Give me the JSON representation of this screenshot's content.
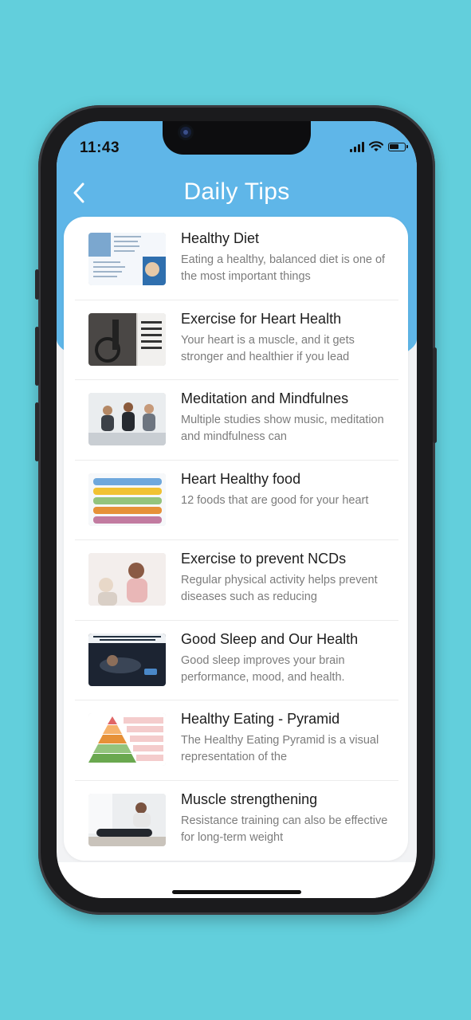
{
  "status": {
    "time": "11:43"
  },
  "nav": {
    "title": "Daily Tips",
    "back_icon": "chevron-left-icon"
  },
  "tips": [
    {
      "title": "Healthy Diet",
      "desc": "Eating a healthy, balanced diet is one of the most important things"
    },
    {
      "title": "Exercise for Heart Health",
      "desc": "Your heart is a muscle, and it gets stronger and healthier if you lead"
    },
    {
      "title": "Meditation and Mindfulnes",
      "desc": "Multiple studies show music, meditation and mindfulness can"
    },
    {
      "title": "Heart Healthy food",
      "desc": "12 foods that are good for your heart"
    },
    {
      "title": "Exercise to prevent NCDs",
      "desc": "Regular physical activity helps prevent diseases such as reducing"
    },
    {
      "title": "Good Sleep and Our Health",
      "desc": "Good sleep improves your brain performance, mood, and health."
    },
    {
      "title": "Healthy Eating - Pyramid",
      "desc": "The Healthy Eating Pyramid is a visual representation of the"
    },
    {
      "title": "Muscle strengthening",
      "desc": "Resistance training can also be effective for long-term weight"
    }
  ],
  "colors": {
    "background": "#62cfdc",
    "header": "#5fb6e8"
  }
}
